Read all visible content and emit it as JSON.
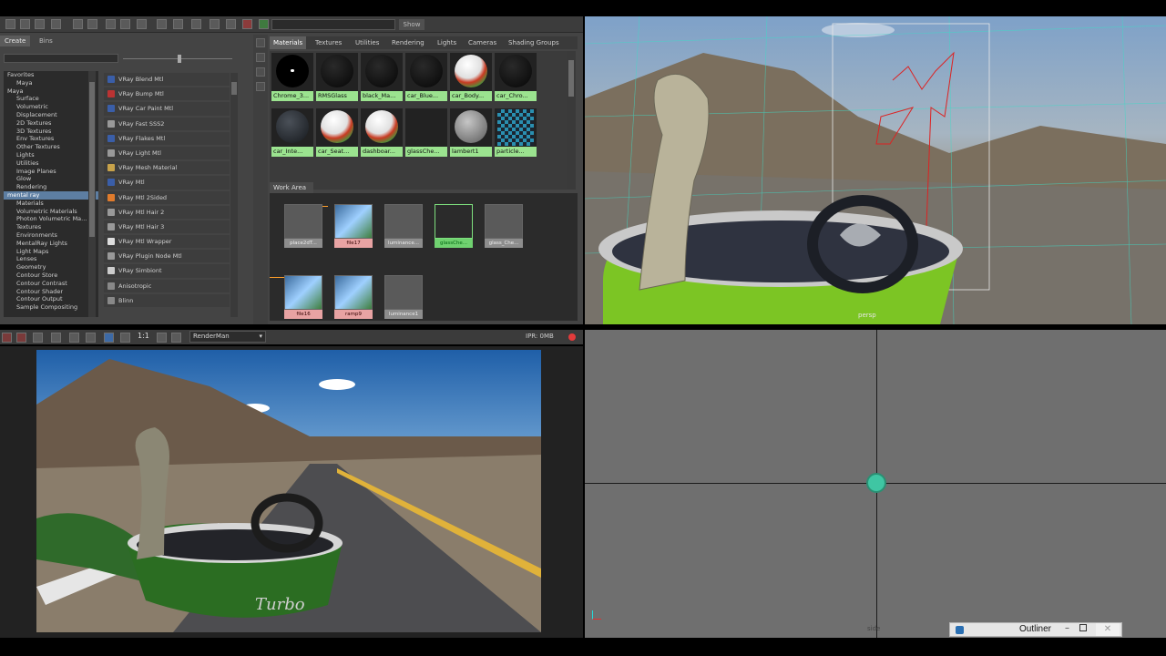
{
  "hypershade": {
    "show_label": "Show",
    "create_tabs": [
      "Create",
      "Bins"
    ],
    "tree_items": [
      "Favorites",
      "Maya",
      "Maya",
      "Surface",
      "Volumetric",
      "Displacement",
      "2D Textures",
      "3D Textures",
      "Env Textures",
      "Other Textures",
      "Lights",
      "Utilities",
      "Image Planes",
      "Glow",
      "Rendering",
      "mental ray",
      "Materials",
      "Volumetric Materials",
      "Photon Volumetric Ma...",
      "Textures",
      "Environments",
      "MentalRay Lights",
      "Light Maps",
      "Lenses",
      "Geometry",
      "Contour Store",
      "Contour Contrast",
      "Contour Shader",
      "Contour Output",
      "Sample Compositing"
    ],
    "selected_tree_item": "mental ray",
    "nodes": [
      "VRay Blend Mtl",
      "VRay Bump Mtl",
      "VRay Car Paint Mtl",
      "VRay Fast SSS2",
      "VRay Flakes Mtl",
      "VRay Light Mtl",
      "VRay Mesh Material",
      "VRay Mtl",
      "VRay Mtl 2Sided",
      "VRay Mtl Hair 2",
      "VRay Mtl Hair 3",
      "VRay Mtl Wrapper",
      "VRay Plugin Node Mtl",
      "VRay Simbiont",
      "Anisotropic",
      "Blinn"
    ],
    "material_tabs": [
      "Materials",
      "Textures",
      "Utilities",
      "Rendering",
      "Lights",
      "Cameras",
      "Shading Groups"
    ],
    "active_material_tab": "Materials",
    "swatches": [
      {
        "label": "Chrome_3...",
        "kind": "dot"
      },
      {
        "label": "RMSGlass",
        "kind": "black"
      },
      {
        "label": "black_Ma...",
        "kind": "black"
      },
      {
        "label": "car_Blue...",
        "kind": "black"
      },
      {
        "label": "car_Body...",
        "kind": "helmet"
      },
      {
        "label": "car_Chro...",
        "kind": "black"
      },
      {
        "label": "car_Inte...",
        "kind": "dark"
      },
      {
        "label": "car_Seat...",
        "kind": "helmet"
      },
      {
        "label": "dashboar...",
        "kind": "helmet"
      },
      {
        "label": "glassChe...",
        "kind": "empty"
      },
      {
        "label": "lambert1",
        "kind": "gray"
      },
      {
        "label": "particle...",
        "kind": "checker"
      }
    ],
    "work_area_tab": "Work Area",
    "work_nodes": [
      {
        "label": "place2dT...",
        "style": "gray"
      },
      {
        "label": "file17",
        "style": "pink"
      },
      {
        "label": "luminance...",
        "style": "gray"
      },
      {
        "label": "glassChe...",
        "style": "green"
      },
      {
        "label": "glass_Che...",
        "style": "gray"
      },
      {
        "label": "file16",
        "style": "pink"
      },
      {
        "label": "ramp9",
        "style": "pink"
      },
      {
        "label": "luminance1",
        "style": "gray"
      }
    ]
  },
  "render_view": {
    "ratio": "1:1",
    "renderer": "RenderMan",
    "ipr_label": "IPR: 0MB"
  },
  "viewports": {
    "persp_label": "persp",
    "side_label": "side"
  },
  "outliner": {
    "title": "Outliner"
  }
}
